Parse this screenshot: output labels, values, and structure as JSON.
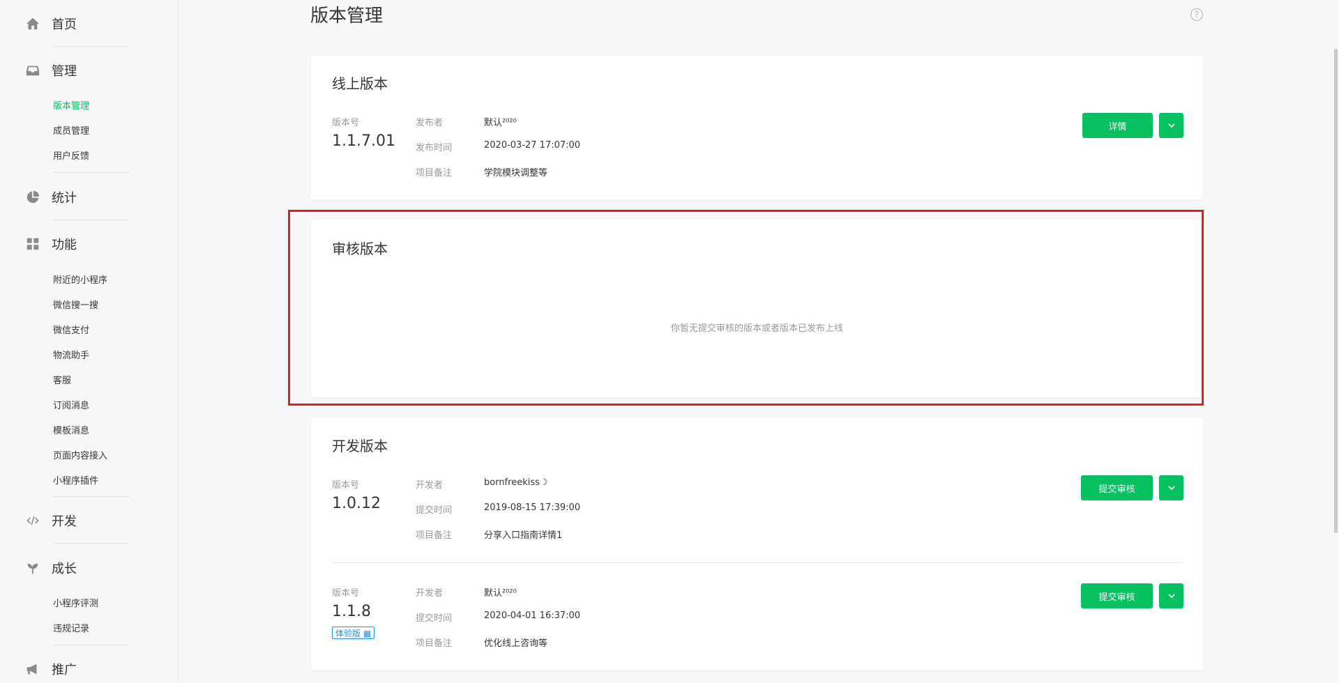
{
  "sidebar": {
    "home": {
      "label": "首页",
      "icon": "home-icon"
    },
    "manage": {
      "label": "管理",
      "icon": "inbox-icon",
      "items": [
        "版本管理",
        "成员管理",
        "用户反馈"
      ]
    },
    "stats": {
      "label": "统计",
      "icon": "pie-chart-icon"
    },
    "features": {
      "label": "功能",
      "icon": "grid-icon",
      "items": [
        "附近的小程序",
        "微信搜一搜",
        "微信支付",
        "物流助手",
        "客服",
        "订阅消息",
        "模板消息",
        "页面内容接入",
        "小程序插件"
      ]
    },
    "develop": {
      "label": "开发",
      "icon": "code-icon"
    },
    "growth": {
      "label": "成长",
      "icon": "sprout-icon",
      "items": [
        "小程序评测",
        "违规记录"
      ]
    },
    "promote": {
      "label": "推广",
      "icon": "megaphone-icon"
    }
  },
  "main": {
    "title": "版本管理",
    "help": "?",
    "online": {
      "title": "线上版本",
      "version_key": "版本号",
      "version": "1.1.7.01",
      "publisher_key": "发布者",
      "publisher": "默认²⁰²⁰",
      "time_key": "发布时间",
      "time": "2020-03-27 17:07:00",
      "note_key": "项目备注",
      "note": "学院模块调整等",
      "detail_btn": "详情"
    },
    "review": {
      "title": "审核版本",
      "empty": "你暂无提交审核的版本或者版本已发布上线"
    },
    "dev": {
      "title": "开发版本",
      "items": [
        {
          "version_key": "版本号",
          "version": "1.0.12",
          "dev_key": "开发者",
          "developer": "bornfreekiss☽",
          "time_key": "提交时间",
          "time": "2019-08-15 17:39:00",
          "note_key": "项目备注",
          "note": "分享入口指南详情1",
          "submit_btn": "提交审核"
        },
        {
          "version_key": "版本号",
          "version": "1.1.8",
          "badge": "体验版 ▦",
          "dev_key": "开发者",
          "developer": "默认²⁰²⁰",
          "time_key": "提交时间",
          "time": "2020-04-01 16:37:00",
          "note_key": "项目备注",
          "note": "优化线上咨询等",
          "submit_btn": "提交审核"
        }
      ]
    }
  },
  "colors": {
    "accent": "#07c160",
    "highlight": "#e02020",
    "badge": "#1e90e8"
  }
}
